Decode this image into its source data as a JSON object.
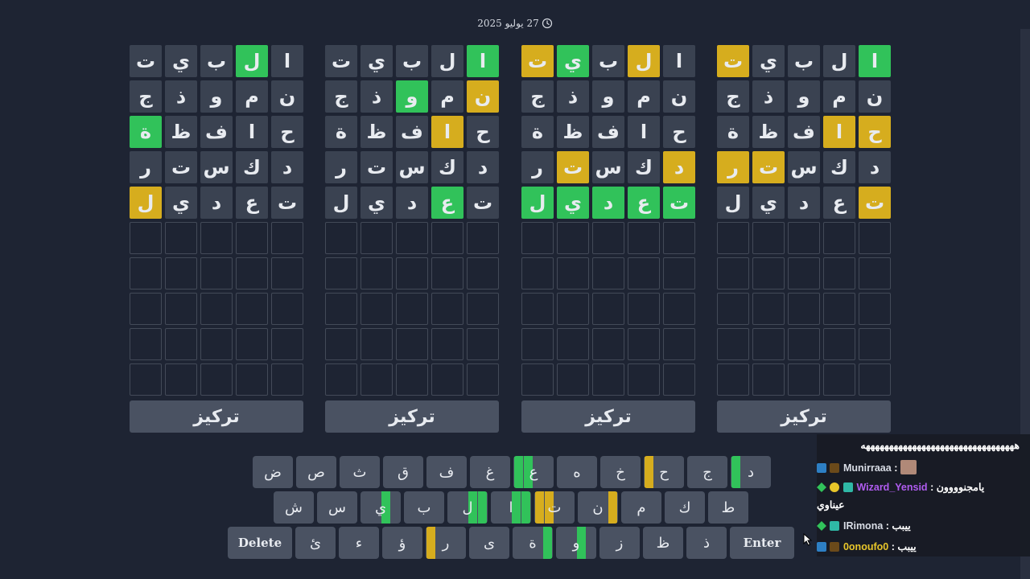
{
  "date_text": "27 يوليو 2025",
  "boards": [
    {
      "rows": [
        [
          {
            "l": "ا",
            "s": "c"
          },
          {
            "l": "ل",
            "s": "g"
          },
          {
            "l": "ب",
            "s": "g"
          },
          {
            "l": "ي",
            "s": "g"
          },
          {
            "l": "ت",
            "s": "p"
          }
        ],
        [
          {
            "l": "ن",
            "s": "g"
          },
          {
            "l": "م",
            "s": "g"
          },
          {
            "l": "و",
            "s": "g"
          },
          {
            "l": "ذ",
            "s": "g"
          },
          {
            "l": "ج",
            "s": "g"
          }
        ],
        [
          {
            "l": "ح",
            "s": "p"
          },
          {
            "l": "ا",
            "s": "p"
          },
          {
            "l": "ف",
            "s": "g"
          },
          {
            "l": "ظ",
            "s": "g"
          },
          {
            "l": "ة",
            "s": "g"
          }
        ],
        [
          {
            "l": "د",
            "s": "g"
          },
          {
            "l": "ك",
            "s": "g"
          },
          {
            "l": "س",
            "s": "g"
          },
          {
            "l": "ت",
            "s": "p"
          },
          {
            "l": "ر",
            "s": "p"
          }
        ],
        [
          {
            "l": "ت",
            "s": "p"
          },
          {
            "l": "ع",
            "s": "g"
          },
          {
            "l": "د",
            "s": "g"
          },
          {
            "l": "ي",
            "s": "g"
          },
          {
            "l": "ل",
            "s": "g"
          }
        ]
      ],
      "focus_label": "تركيز"
    },
    {
      "rows": [
        [
          {
            "l": "ا",
            "s": "g"
          },
          {
            "l": "ل",
            "s": "p"
          },
          {
            "l": "ب",
            "s": "g"
          },
          {
            "l": "ي",
            "s": "c"
          },
          {
            "l": "ت",
            "s": "p"
          }
        ],
        [
          {
            "l": "ن",
            "s": "g"
          },
          {
            "l": "م",
            "s": "g"
          },
          {
            "l": "و",
            "s": "g"
          },
          {
            "l": "ذ",
            "s": "g"
          },
          {
            "l": "ج",
            "s": "g"
          }
        ],
        [
          {
            "l": "ح",
            "s": "g"
          },
          {
            "l": "ا",
            "s": "g"
          },
          {
            "l": "ف",
            "s": "g"
          },
          {
            "l": "ظ",
            "s": "g"
          },
          {
            "l": "ة",
            "s": "g"
          }
        ],
        [
          {
            "l": "د",
            "s": "p"
          },
          {
            "l": "ك",
            "s": "g"
          },
          {
            "l": "س",
            "s": "g"
          },
          {
            "l": "ت",
            "s": "p"
          },
          {
            "l": "ر",
            "s": "g"
          }
        ],
        [
          {
            "l": "ت",
            "s": "c"
          },
          {
            "l": "ع",
            "s": "c"
          },
          {
            "l": "د",
            "s": "c"
          },
          {
            "l": "ي",
            "s": "c"
          },
          {
            "l": "ل",
            "s": "c"
          }
        ]
      ],
      "focus_label": "تركيز"
    },
    {
      "rows": [
        [
          {
            "l": "ا",
            "s": "c"
          },
          {
            "l": "ل",
            "s": "g"
          },
          {
            "l": "ب",
            "s": "g"
          },
          {
            "l": "ي",
            "s": "g"
          },
          {
            "l": "ت",
            "s": "g"
          }
        ],
        [
          {
            "l": "ن",
            "s": "p"
          },
          {
            "l": "م",
            "s": "g"
          },
          {
            "l": "و",
            "s": "c"
          },
          {
            "l": "ذ",
            "s": "g"
          },
          {
            "l": "ج",
            "s": "g"
          }
        ],
        [
          {
            "l": "ح",
            "s": "g"
          },
          {
            "l": "ا",
            "s": "p"
          },
          {
            "l": "ف",
            "s": "g"
          },
          {
            "l": "ظ",
            "s": "g"
          },
          {
            "l": "ة",
            "s": "g"
          }
        ],
        [
          {
            "l": "د",
            "s": "g"
          },
          {
            "l": "ك",
            "s": "g"
          },
          {
            "l": "س",
            "s": "g"
          },
          {
            "l": "ت",
            "s": "g"
          },
          {
            "l": "ر",
            "s": "g"
          }
        ],
        [
          {
            "l": "ت",
            "s": "g"
          },
          {
            "l": "ع",
            "s": "c"
          },
          {
            "l": "د",
            "s": "g"
          },
          {
            "l": "ي",
            "s": "g"
          },
          {
            "l": "ل",
            "s": "g"
          }
        ]
      ],
      "focus_label": "تركيز"
    },
    {
      "rows": [
        [
          {
            "l": "ا",
            "s": "g"
          },
          {
            "l": "ل",
            "s": "c"
          },
          {
            "l": "ب",
            "s": "g"
          },
          {
            "l": "ي",
            "s": "g"
          },
          {
            "l": "ت",
            "s": "g"
          }
        ],
        [
          {
            "l": "ن",
            "s": "g"
          },
          {
            "l": "م",
            "s": "g"
          },
          {
            "l": "و",
            "s": "g"
          },
          {
            "l": "ذ",
            "s": "g"
          },
          {
            "l": "ج",
            "s": "g"
          }
        ],
        [
          {
            "l": "ح",
            "s": "g"
          },
          {
            "l": "ا",
            "s": "g"
          },
          {
            "l": "ف",
            "s": "g"
          },
          {
            "l": "ظ",
            "s": "g"
          },
          {
            "l": "ة",
            "s": "c"
          }
        ],
        [
          {
            "l": "د",
            "s": "g"
          },
          {
            "l": "ك",
            "s": "g"
          },
          {
            "l": "س",
            "s": "g"
          },
          {
            "l": "ت",
            "s": "g"
          },
          {
            "l": "ر",
            "s": "g"
          }
        ],
        [
          {
            "l": "ت",
            "s": "g"
          },
          {
            "l": "ع",
            "s": "g"
          },
          {
            "l": "د",
            "s": "g"
          },
          {
            "l": "ي",
            "s": "g"
          },
          {
            "l": "ل",
            "s": "p"
          }
        ]
      ],
      "focus_label": "تركيز"
    }
  ],
  "keyboard": {
    "row1": [
      {
        "l": "د",
        "b": [
          null,
          null,
          null,
          "c"
        ]
      },
      {
        "l": "ج",
        "b": [
          null,
          null,
          null,
          null
        ]
      },
      {
        "l": "ح",
        "b": [
          null,
          null,
          null,
          "p"
        ]
      },
      {
        "l": "خ",
        "b": [
          null,
          null,
          null,
          null
        ]
      },
      {
        "l": "ه",
        "b": [
          null,
          null,
          null,
          null
        ]
      },
      {
        "l": "ع",
        "b": [
          null,
          null,
          "c",
          "c"
        ]
      },
      {
        "l": "غ",
        "b": [
          null,
          null,
          null,
          null
        ]
      },
      {
        "l": "ف",
        "b": [
          null,
          null,
          null,
          null
        ]
      },
      {
        "l": "ق",
        "b": [
          null,
          null,
          null,
          null
        ]
      },
      {
        "l": "ث",
        "b": [
          null,
          null,
          null,
          null
        ]
      },
      {
        "l": "ص",
        "b": [
          null,
          null,
          null,
          null
        ]
      },
      {
        "l": "ض",
        "b": [
          null,
          null,
          null,
          null
        ]
      }
    ],
    "row2": [
      {
        "l": "ط",
        "b": [
          null,
          null,
          null,
          null
        ]
      },
      {
        "l": "ك",
        "b": [
          null,
          null,
          null,
          null
        ]
      },
      {
        "l": "م",
        "b": [
          null,
          null,
          null,
          null
        ]
      },
      {
        "l": "ن",
        "b": [
          "p",
          null,
          null,
          null
        ]
      },
      {
        "l": "ت",
        "b": [
          null,
          null,
          "p",
          "p"
        ]
      },
      {
        "l": "ا",
        "b": [
          "c",
          "c",
          null,
          null
        ]
      },
      {
        "l": "ل",
        "b": [
          "c",
          "c",
          null,
          null
        ]
      },
      {
        "l": "ب",
        "b": [
          null,
          null,
          null,
          null
        ]
      },
      {
        "l": "ي",
        "b": [
          null,
          "c",
          null,
          null
        ]
      },
      {
        "l": "س",
        "b": [
          null,
          null,
          null,
          null
        ]
      },
      {
        "l": "ش",
        "b": [
          null,
          null,
          null,
          null
        ]
      }
    ],
    "row3": [
      {
        "l": "Enter",
        "b": [
          null,
          null,
          null,
          null
        ],
        "wide": true
      },
      {
        "l": "ذ",
        "b": [
          null,
          null,
          null,
          null
        ]
      },
      {
        "l": "ظ",
        "b": [
          null,
          null,
          null,
          null
        ]
      },
      {
        "l": "ز",
        "b": [
          null,
          null,
          null,
          null
        ]
      },
      {
        "l": "و",
        "b": [
          null,
          "c",
          null,
          null
        ]
      },
      {
        "l": "ة",
        "b": [
          "c",
          null,
          null,
          null
        ]
      },
      {
        "l": "ى",
        "b": [
          null,
          null,
          null,
          null
        ]
      },
      {
        "l": "ر",
        "b": [
          null,
          null,
          null,
          "p"
        ]
      },
      {
        "l": "ؤ",
        "b": [
          null,
          null,
          null,
          null
        ]
      },
      {
        "l": "ء",
        "b": [
          null,
          null,
          null,
          null
        ]
      },
      {
        "l": "ئ",
        "b": [
          null,
          null,
          null,
          null
        ]
      },
      {
        "l": "Delete",
        "b": [
          null,
          null,
          null,
          null
        ],
        "wide": true
      }
    ]
  },
  "chat": {
    "top_message": "هههههههههههههههههههههههههههههههههه",
    "messages": [
      {
        "user": "Munirraaa",
        "user_color": "#d9dde6",
        "text": ""
      },
      {
        "user": "Wizard_Yensid",
        "user_color": "#b05cf0",
        "text": "يامجنوووون",
        "text2": "عيناوي"
      },
      {
        "user": "IRimona",
        "user_color": "#d9dde6",
        "text": "ييبب"
      },
      {
        "user": "0onoufo0",
        "user_color": "#e8c62a",
        "text": "ييبب"
      }
    ]
  },
  "colors": {
    "correct": "#31c25a",
    "present": "#d6ad1e",
    "absent": "#3a4251",
    "empty": "#434a58",
    "background": "#1e2433"
  }
}
